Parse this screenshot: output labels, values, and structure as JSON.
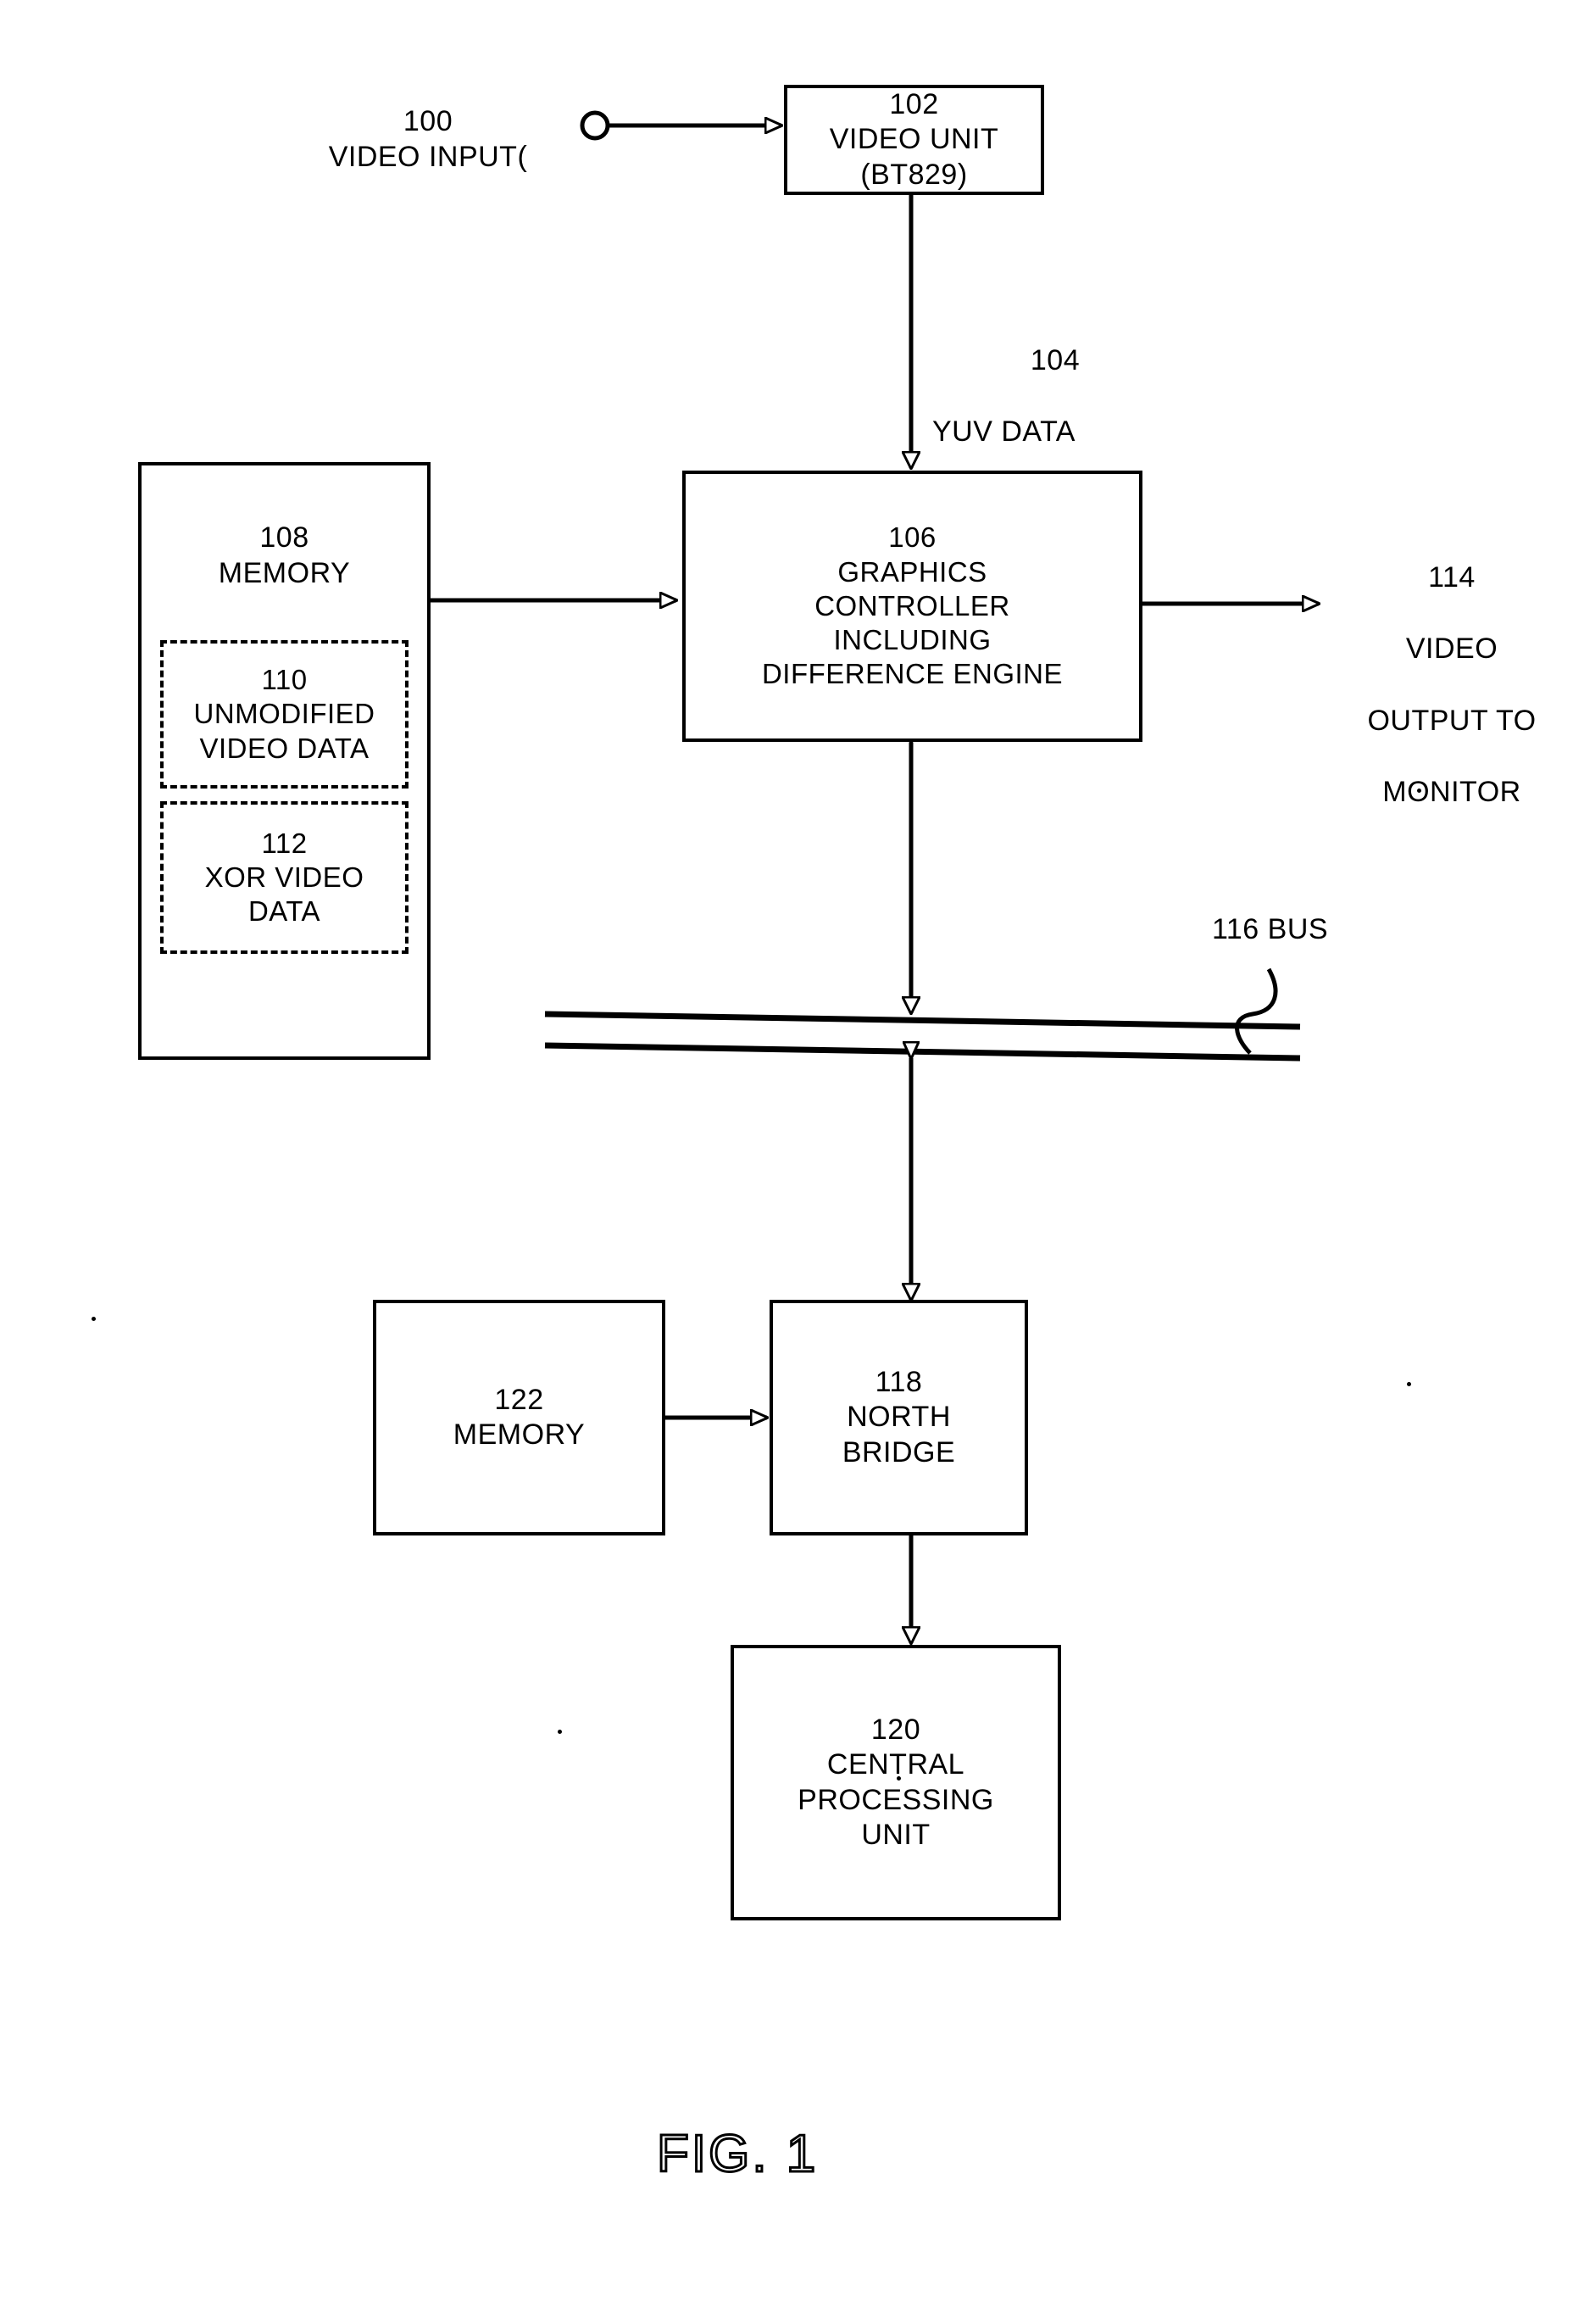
{
  "figure": {
    "caption": "FIG. 1",
    "type": "patent-block-diagram"
  },
  "nodes": {
    "video_input": {
      "ref": "100",
      "label": "VIDEO INPUT(",
      "text": "100\nVIDEO INPUT("
    },
    "video_unit": {
      "ref": "102",
      "line1": "102",
      "line2": "VIDEO UNIT",
      "line3": "(BT829)"
    },
    "yuv_data": {
      "ref": "104",
      "line1": "104",
      "line2": "YUV DATA"
    },
    "graphics_controller": {
      "ref": "106",
      "line1": "106",
      "line2": "GRAPHICS",
      "line3": "CONTROLLER",
      "line4": "INCLUDING",
      "line5": "DIFFERENCE ENGINE"
    },
    "memory_108": {
      "ref": "108",
      "line1": "108",
      "line2": "MEMORY"
    },
    "unmodified_video_data": {
      "ref": "110",
      "line1": "110",
      "line2": "UNMODIFIED",
      "line3": "VIDEO DATA"
    },
    "xor_video_data": {
      "ref": "112",
      "line1": "112",
      "line2": "XOR VIDEO",
      "line3": "DATA"
    },
    "video_output": {
      "ref": "114",
      "line1": "114",
      "line2": "VIDEO",
      "line3": "OUTPUT TO",
      "line4": "MONITOR"
    },
    "bus": {
      "ref": "116",
      "label": "116 BUS"
    },
    "north_bridge": {
      "ref": "118",
      "line1": "118",
      "line2": "NORTH",
      "line3": "BRIDGE"
    },
    "cpu": {
      "ref": "120",
      "line1": "120",
      "line2": "CENTRAL",
      "line3": "PROCESSING",
      "line4": "UNIT"
    },
    "memory_122": {
      "ref": "122",
      "line1": "122",
      "line2": "MEMORY"
    }
  },
  "colors": {
    "ink": "#000000",
    "paper": "#ffffff"
  }
}
